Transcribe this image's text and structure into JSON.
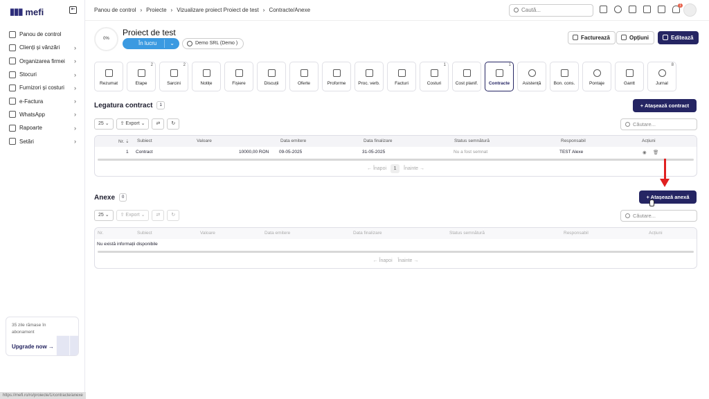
{
  "app": {
    "logo_text": "mefi",
    "brand_color": "#252563",
    "status_url": "https://mefi.ro/ro/proiecte/1/contracte/anexe"
  },
  "sidebar": {
    "items": [
      {
        "label": "Panou de control",
        "icon": "home-icon",
        "chevron": false
      },
      {
        "label": "Clienți și vânzări",
        "icon": "users-icon",
        "chevron": true
      },
      {
        "label": "Organizarea firmei",
        "icon": "org-icon",
        "chevron": true
      },
      {
        "label": "Stocuri",
        "icon": "box-icon",
        "chevron": true
      },
      {
        "label": "Furnizori și costuri",
        "icon": "wallet-icon",
        "chevron": true
      },
      {
        "label": "e-Factura",
        "icon": "efactura-icon",
        "chevron": true
      },
      {
        "label": "WhatsApp",
        "icon": "whatsapp-icon",
        "chevron": true
      },
      {
        "label": "Rapoarte",
        "icon": "report-icon",
        "chevron": true
      },
      {
        "label": "Setări",
        "icon": "gear-icon",
        "chevron": true
      }
    ]
  },
  "upgrade": {
    "text": "35 zile rămase în abonament",
    "link": "Upgrade now",
    "arrow": "→"
  },
  "breadcrumb": [
    "Panou de control",
    "Proiecte",
    "Vizualizare proiect Proiect de test",
    "Contracte/Anexe"
  ],
  "breadcrumb_sep": "›",
  "search": {
    "placeholder": "Caută..."
  },
  "notifications": {
    "count": "1"
  },
  "project": {
    "progress": "0%",
    "title": "Proiect de test",
    "status": "În lucru",
    "client": "Demo SRL (Demo )"
  },
  "actions": {
    "invoice": "Facturează",
    "options": "Opțiuni",
    "edit": "Editează"
  },
  "tabs": [
    {
      "label": "Rezumat",
      "count": ""
    },
    {
      "label": "Etape",
      "count": "2"
    },
    {
      "label": "Sarcini",
      "count": "2"
    },
    {
      "label": "Notițe",
      "count": ""
    },
    {
      "label": "Fișiere",
      "count": ""
    },
    {
      "label": "Discuții",
      "count": ""
    },
    {
      "label": "Oferte",
      "count": ""
    },
    {
      "label": "Proforme",
      "count": ""
    },
    {
      "label": "Proc. verb.",
      "count": ""
    },
    {
      "label": "Facturi",
      "count": ""
    },
    {
      "label": "Costuri",
      "count": "1"
    },
    {
      "label": "Cost planif.",
      "count": ""
    },
    {
      "label": "Contracte",
      "count": "1"
    },
    {
      "label": "Asistență",
      "count": ""
    },
    {
      "label": "Bon. cons.",
      "count": ""
    },
    {
      "label": "Pontaje",
      "count": ""
    },
    {
      "label": "Gantt",
      "count": ""
    },
    {
      "label": "Jurnal",
      "count": "8"
    }
  ],
  "contracts": {
    "title": "Legatura contract",
    "count": "1",
    "attach": "+ Atașează contract",
    "page_size": "25 ⌄",
    "export": "⇪ Export ⌄",
    "refresh": "⇄",
    "reload": "↻",
    "search_placeholder": "Căutare...",
    "columns": [
      "Nr. ⇣",
      "Subiect",
      "Valoare",
      "Data emitere",
      "Data finalizare",
      "Status semnătură",
      "Responsabil",
      "Acțiuni"
    ],
    "rows": [
      {
        "nr": "1",
        "subject": "Contract",
        "value": "10000,00 RON",
        "issue_date": "09-05-2025",
        "end_date": "31-05-2025",
        "signature_status": "Nu a fost semnat",
        "responsible": "TEST Alexe",
        "view": "◉",
        "delete": "🗑"
      }
    ],
    "pager": {
      "prev": "← Înapoi",
      "page": "1",
      "next": "Înainte →"
    }
  },
  "annexes": {
    "title": "Anexe",
    "count": "0",
    "attach": "+ Atașează anexă",
    "page_size": "25 ⌄",
    "export": "⇪ Export ⌄",
    "refresh": "⇄",
    "reload": "↻",
    "search_placeholder": "Căutare...",
    "columns": [
      "Nr.",
      "Subiect",
      "Valoare",
      "Data emitere",
      "Data finalizare",
      "Status semnătură",
      "Responsabil",
      "Acțiuni"
    ],
    "empty": "Nu există informații disponibile",
    "pager": {
      "prev": "← Înapoi",
      "next": "Înainte →"
    }
  }
}
